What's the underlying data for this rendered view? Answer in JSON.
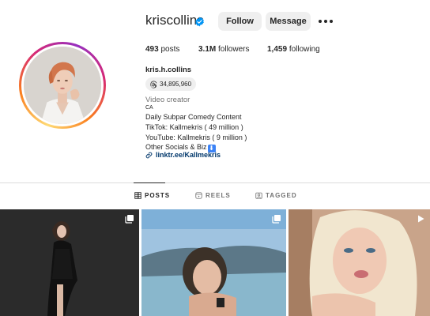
{
  "profile": {
    "username": "kriscollins",
    "verified_icon": "verified-badge-icon",
    "follow_label": "Follow",
    "message_label": "Message",
    "stats": {
      "posts_count": "493",
      "posts_label": "posts",
      "followers_count": "3.1M",
      "followers_label": "followers",
      "following_count": "1,459",
      "following_label": "following"
    },
    "full_name": "kris.h.collins",
    "threads_count": "34,895,960",
    "category": "Video creator",
    "location": "CA",
    "bio_lines": [
      "Daily Subpar Comedy Content",
      "TikTok: Kallmekris ( 49 million )",
      "YouTube: Kallmekris ( 9 million )",
      "Other Socials & Biz"
    ],
    "bio_emoji": "⬇",
    "link_text": "linktr.ee/Kallmekris"
  },
  "tabs": [
    {
      "label": "POSTS",
      "icon": "grid-icon",
      "active": true
    },
    {
      "label": "REELS",
      "icon": "reels-icon",
      "active": false
    },
    {
      "label": "TAGGED",
      "icon": "tagged-icon",
      "active": false
    }
  ],
  "grid": [
    {
      "type": "carousel",
      "icon": "carousel-icon"
    },
    {
      "type": "carousel",
      "icon": "carousel-icon"
    },
    {
      "type": "reel",
      "icon": "reel-play-icon"
    }
  ],
  "colors": {
    "link": "#00376b",
    "verified": "#0095f6",
    "button_bg": "#efefef",
    "muted": "#737373"
  }
}
